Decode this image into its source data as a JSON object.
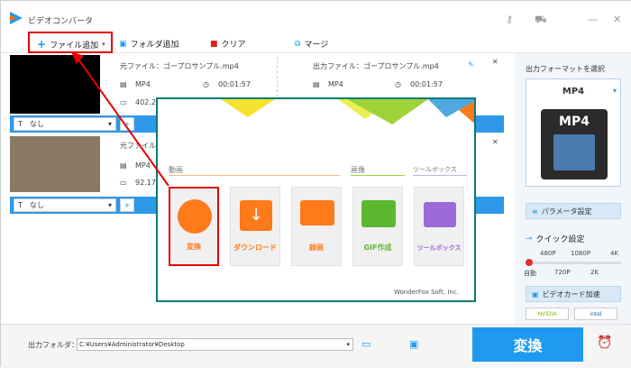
{
  "app": {
    "title": "ビデオコンバータ"
  },
  "toolbar": {
    "add_file": "ファイル追加",
    "add_folder": "フォルダ追加",
    "clear": "クリア",
    "merge": "マージ"
  },
  "files": [
    {
      "source_label": "元ファイル：",
      "source_name": "ゴープロサンプル.mp4",
      "source_format": "MP4",
      "source_duration": "00:01:57",
      "source_size_partial": "402.2",
      "output_label": "出力ファイル：",
      "output_name": "ゴープロサンプル.mp4",
      "output_format": "MP4",
      "output_duration": "00:01:57",
      "subtitle": "なし"
    },
    {
      "source_label": "元ファイル",
      "source_format": "MP4",
      "source_size_partial": "92.17",
      "subtitle": "なし"
    }
  ],
  "popup": {
    "section_video": "動画",
    "section_image": "画像",
    "section_tools": "ツールボックス",
    "tiles": [
      "変換",
      "ダウンロード",
      "録画",
      "GIF作成",
      "ツールボックス"
    ],
    "footer": "WonderFox Soft, Inc."
  },
  "right_panel": {
    "title": "出力フォーマットを選択",
    "format": "MP4",
    "format_art": "MP4",
    "params_button": "パラメータ設定",
    "quick_settings": "クイック設定",
    "quality_top": [
      "480P",
      "1080P",
      "4K"
    ],
    "quality_bottom": [
      "自動",
      "720P",
      "2K"
    ],
    "gpu_accel": "ビデオカード加速",
    "gpu_badges": [
      "NVIDIA",
      "intel"
    ]
  },
  "bottom": {
    "output_folder_label": "出力フォルダ：",
    "output_path": "C:¥Users¥Administrator¥Desktop",
    "convert": "変換"
  },
  "colors": {
    "accent": "#1e9bf0",
    "highlight": "#e60000",
    "tile_orange": "#ff7a1a",
    "popup_border": "#0c7b74"
  }
}
